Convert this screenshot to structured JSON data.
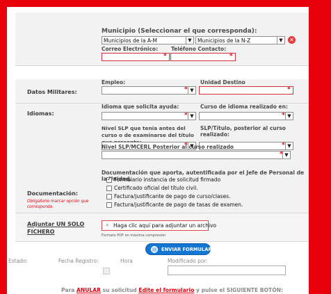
{
  "municipio": {
    "label": "Municipio (Seleccionar el que corresponda):",
    "select_am": "Municipios de la A-M",
    "select_nz": "Municipios de la N-Z",
    "email_label": "Correo Electrónico:",
    "phone_label": "Teléfono Contacto:"
  },
  "militar": {
    "section_label": "Datos Militares:",
    "empleo_label": "Empleo:",
    "unidad_label": "Unidad Destino"
  },
  "idiomas": {
    "section_label": "Idiomas:",
    "ayuda_label": "Idioma que solicita ayuda:",
    "curso_label": "Curso de idioma realizado en:",
    "nivel_antes_label": "Nivel SLP que tenía antes del curso o de examinarse del título que presenta:",
    "slp_label": "SLP/Título, posterior al curso realizado:",
    "nivel_post_label": "Nivel SLP/MCERL Posterior al curso realizado"
  },
  "documentacion": {
    "section_label": "Documentación:",
    "note": "Obligatorio marcar opción que corresponda.",
    "title": "Documentación que aporta, autentificada por el Jefe de Personal de la Unidad.",
    "items": [
      "Formulario instancia de solicitud firmado",
      "Certificado oficial del título civil.",
      "Factura/justificante de pago de curso/clases.",
      "Factura/justificante de pago de tasas de examen."
    ],
    "checked": [
      true,
      false,
      false,
      false
    ]
  },
  "adjuntar": {
    "label": "Adjuntar UN SOLO FICHERO",
    "button": "Haga clic aquí para adjuntar un archivo",
    "hint": "Formato PDF en máxima compresión"
  },
  "enviar": {
    "label": "ENVIAR FORMULARIO"
  },
  "footer": {
    "estado": "Estado:",
    "fecha": "Fecha Registro:",
    "hora": "Hora",
    "modificado": "Modificado por:",
    "anular_prefix": "Para",
    "anular": "ANULAR",
    "anular_mid": "su solicitud",
    "edite": "Edite el formulario",
    "anular_suffix": "y pulse el SIGUIENTE BOTÓN:"
  },
  "required_mark": "*"
}
